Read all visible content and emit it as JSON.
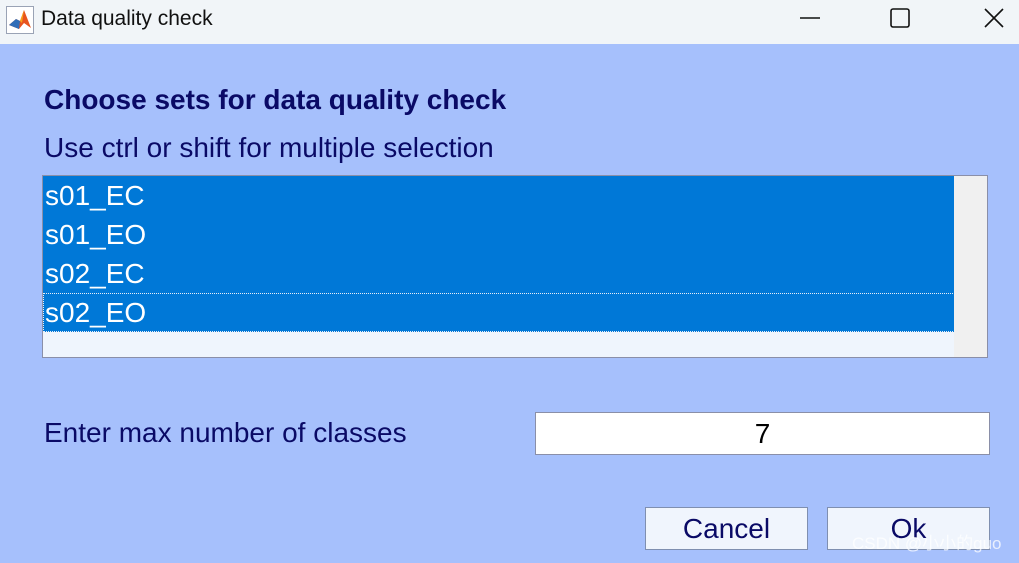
{
  "window": {
    "title": "Data quality check",
    "app_icon": "matlab-icon",
    "controls": [
      "minimize-icon",
      "maximize-icon",
      "close-icon"
    ]
  },
  "dialog": {
    "heading": "Choose sets for data quality check",
    "hint": "Use ctrl or shift for multiple selection",
    "sets": [
      {
        "label": "s01_EC",
        "selected": true
      },
      {
        "label": "s01_EO",
        "selected": true
      },
      {
        "label": "s02_EC",
        "selected": true
      },
      {
        "label": "s02_EO",
        "selected": true,
        "focused": true
      }
    ],
    "classes_label": "Enter max number of classes",
    "classes_value": "7",
    "cancel_label": "Cancel",
    "ok_label": "Ok"
  },
  "watermark": "CSDN @小小的guo",
  "colors": {
    "background": "#a6c0fc",
    "selection": "#0078d7",
    "text": "#0a0a66"
  }
}
